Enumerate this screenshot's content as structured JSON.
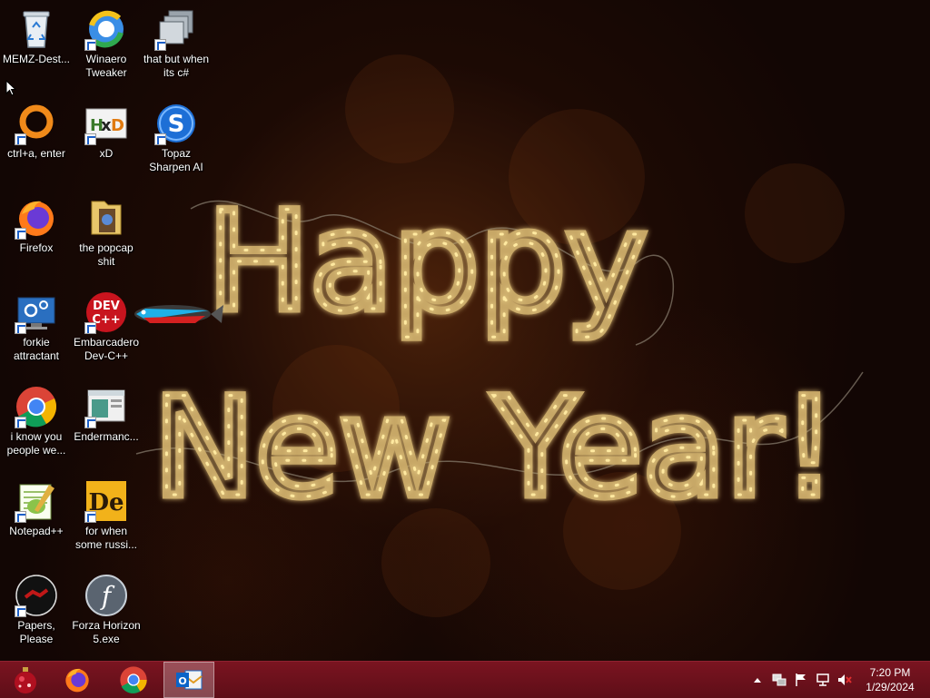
{
  "wallpaper": {
    "line1": "Happy",
    "line2": "New Year!"
  },
  "desktop_icons": [
    {
      "label": "MEMZ-Dest...",
      "icon": "recycle-bin-icon"
    },
    {
      "label": "Winaero Tweaker",
      "icon": "winaero-tweaker-icon"
    },
    {
      "label": "that but when its c#",
      "icon": "windows-stack-icon"
    },
    {
      "label": "ctrl+a, enter",
      "icon": "orange-ring-icon"
    },
    {
      "label": "xD",
      "icon": "hxd-icon"
    },
    {
      "label": "Topaz Sharpen AI",
      "icon": "topaz-icon"
    },
    {
      "label": "Firefox",
      "icon": "firefox-icon"
    },
    {
      "label": "the popcap shit",
      "icon": "folder-icon"
    },
    {
      "label": "forkie attractant",
      "icon": "settings-monitor-icon"
    },
    {
      "label": "Embarcadero Dev-C++",
      "icon": "devcpp-icon"
    },
    {
      "label": "i know you people we...",
      "icon": "chrome-icon"
    },
    {
      "label": "Endermanc...",
      "icon": "window-app-icon"
    },
    {
      "label": "Notepad++",
      "icon": "notepadpp-icon"
    },
    {
      "label": "for when some russi...",
      "icon": "de-icon"
    },
    {
      "label": "Papers, Please",
      "icon": "papers-please-icon"
    },
    {
      "label": "Forza Horizon 5.exe",
      "icon": "flash-icon"
    }
  ],
  "taskbar": {
    "start_icon": "christmas-ornament-icon",
    "pinned": [
      {
        "name": "Firefox",
        "icon": "firefox-icon"
      },
      {
        "name": "Google Chrome",
        "icon": "chrome-icon"
      },
      {
        "name": "Outlook",
        "icon": "outlook-icon",
        "active": true
      }
    ],
    "tray_icons": [
      "show-hidden-icons-chevron",
      "network-adapter-icon",
      "action-center-flag-icon",
      "network-icon",
      "volume-muted-icon"
    ],
    "clock": {
      "time": "7:20 PM",
      "date": "1/29/2024"
    }
  },
  "colors": {
    "taskbar": "#6b1019",
    "wallpaper_bg": "#120604",
    "light_bulb": "#ffe9a0"
  }
}
